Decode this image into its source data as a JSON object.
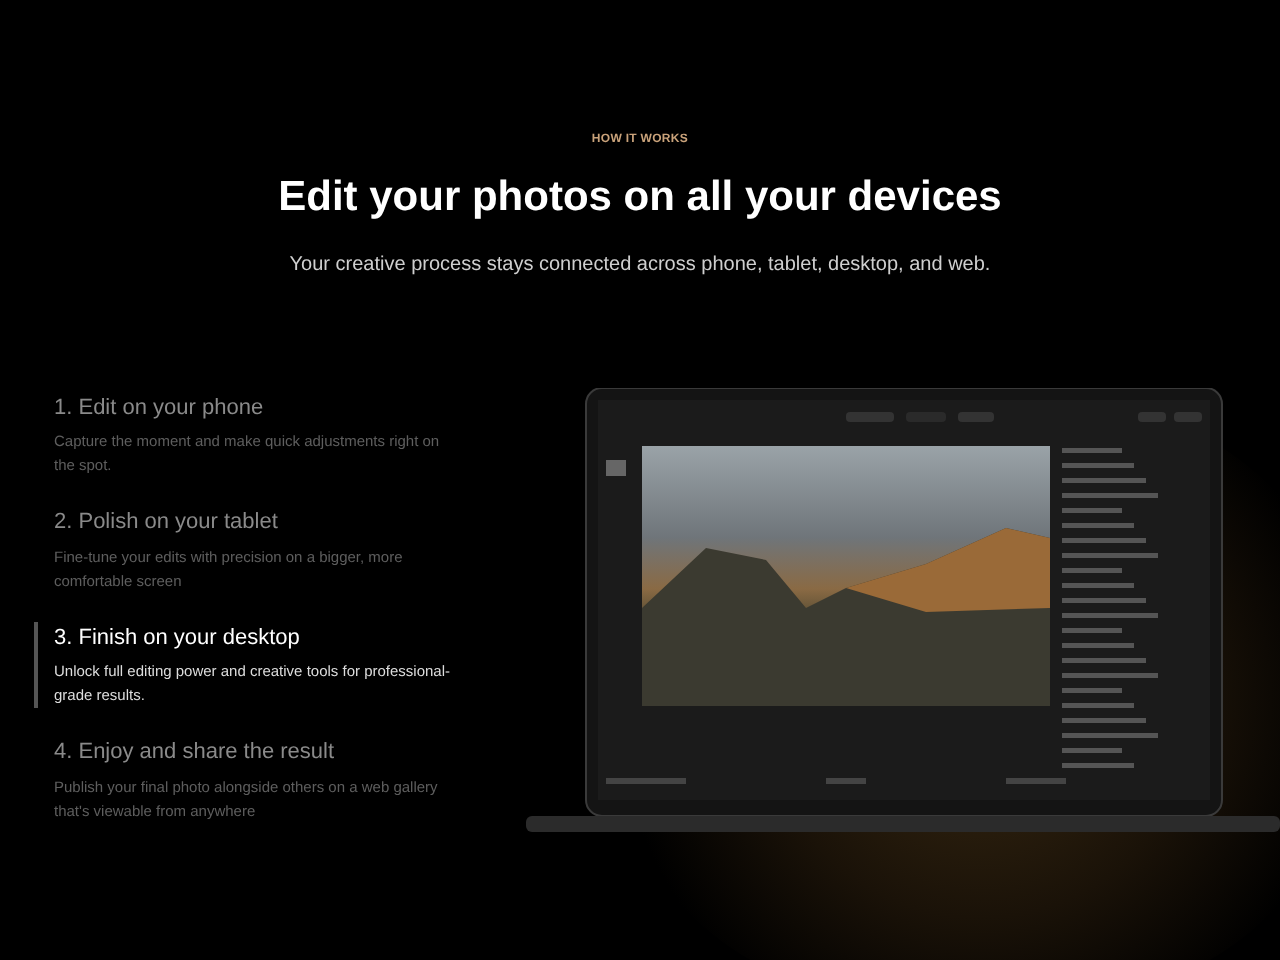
{
  "eyebrow": "HOW IT WORKS",
  "title": "Edit your photos on all your devices",
  "subtitle": "Your creative process stays connected across phone, tablet, desktop, and web.",
  "steps": [
    {
      "title": "1. Edit on your phone",
      "description": "Capture the moment and make quick adjustments right on the spot.",
      "selected": false
    },
    {
      "title": "2. Polish on your tablet",
      "description": "Fine-tune your edits with precision on a bigger, more comfortable screen",
      "selected": false
    },
    {
      "title": "3. Finish on your desktop",
      "description": "Unlock full editing power and creative tools for professional-grade results.",
      "selected": true
    },
    {
      "title": "4. Enjoy and share the result",
      "description": "Publish your final photo alongside others on a web gallery that's viewable from anywhere",
      "selected": false
    }
  ]
}
